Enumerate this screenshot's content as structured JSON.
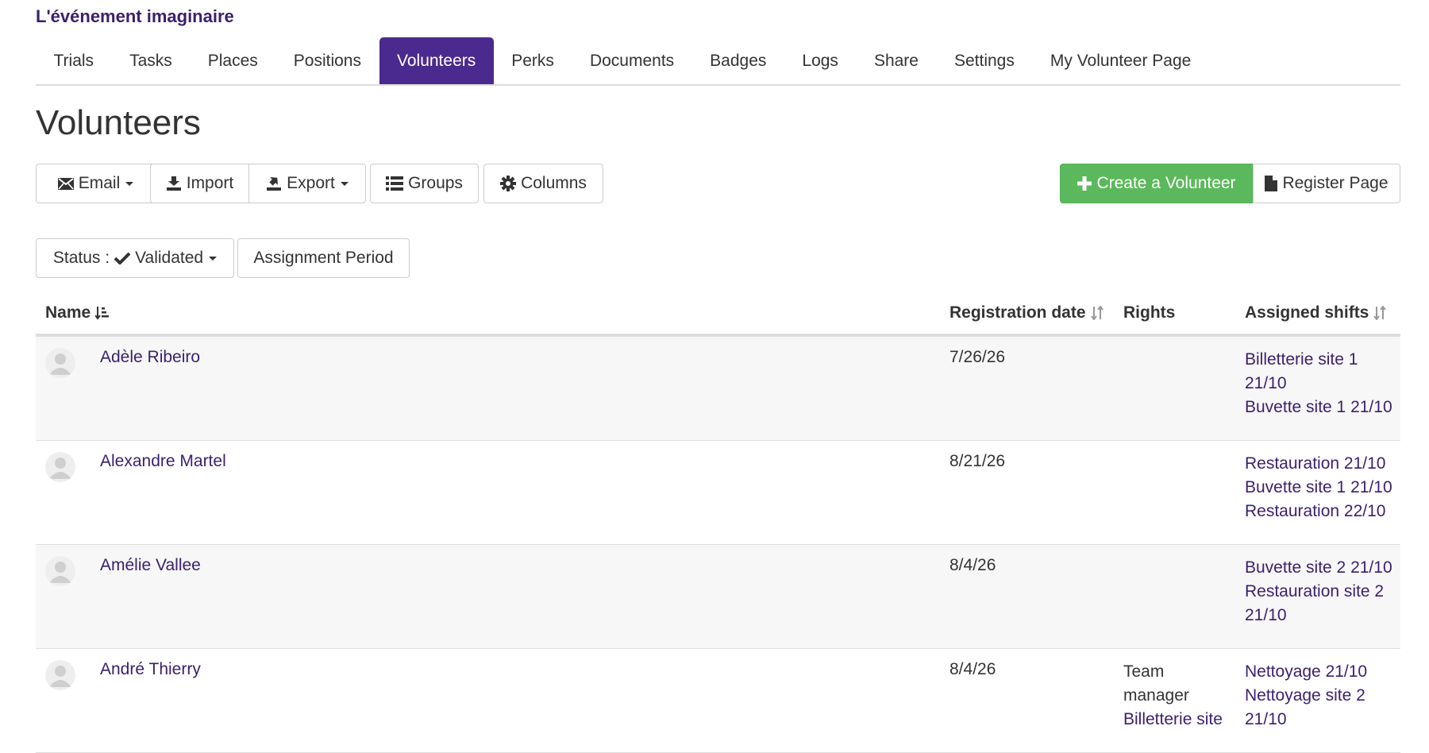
{
  "event": {
    "title": "L'événement imaginaire"
  },
  "tabs": [
    {
      "label": "Trials"
    },
    {
      "label": "Tasks"
    },
    {
      "label": "Places"
    },
    {
      "label": "Positions"
    },
    {
      "label": "Volunteers"
    },
    {
      "label": "Perks"
    },
    {
      "label": "Documents"
    },
    {
      "label": "Badges"
    },
    {
      "label": "Logs"
    },
    {
      "label": "Share"
    },
    {
      "label": "Settings"
    },
    {
      "label": "My Volunteer Page"
    }
  ],
  "active_tab": "Volunteers",
  "page": {
    "title": "Volunteers"
  },
  "toolbar": {
    "email": "Email",
    "import": "Import",
    "export": "Export",
    "groups": "Groups",
    "columns": "Columns",
    "create": "Create a Volunteer",
    "register": "Register Page"
  },
  "filters": {
    "status_prefix": "Status :",
    "status_value": "Validated",
    "period": "Assignment Period"
  },
  "table": {
    "headers": {
      "name": "Name",
      "registration": "Registration date",
      "rights": "Rights",
      "shifts": "Assigned shifts"
    },
    "rows": [
      {
        "name": "Adèle Ribeiro",
        "date": "7/26/26",
        "rights": [
          "",
          ""
        ],
        "shifts": [
          "Billetterie site 1 21/10",
          "Buvette site 1 21/10"
        ]
      },
      {
        "name": "Alexandre Martel",
        "date": "8/21/26",
        "rights": [
          "",
          ""
        ],
        "shifts": [
          "Restauration 21/10",
          "Buvette site 1 21/10",
          "Restauration 22/10"
        ]
      },
      {
        "name": "Amélie Vallee",
        "date": "8/4/26",
        "rights": [
          "",
          ""
        ],
        "shifts": [
          "Buvette site 2 21/10",
          "Restauration site 2 21/10"
        ]
      },
      {
        "name": "André Thierry",
        "date": "8/4/26",
        "rights": [
          "Team manager",
          "Billetterie site"
        ],
        "shifts": [
          "Nettoyage 21/10",
          "Nettoyage site 2 21/10"
        ]
      }
    ]
  },
  "colors": {
    "brand": "#4b2a8f",
    "link": "#3b1f6e",
    "success": "#5cb85c"
  },
  "icons": [
    "envelope-icon",
    "import-icon",
    "export-icon",
    "list-icon",
    "gear-icon",
    "plus-icon",
    "file-icon",
    "check-icon",
    "sort-icon",
    "avatar-icon"
  ]
}
